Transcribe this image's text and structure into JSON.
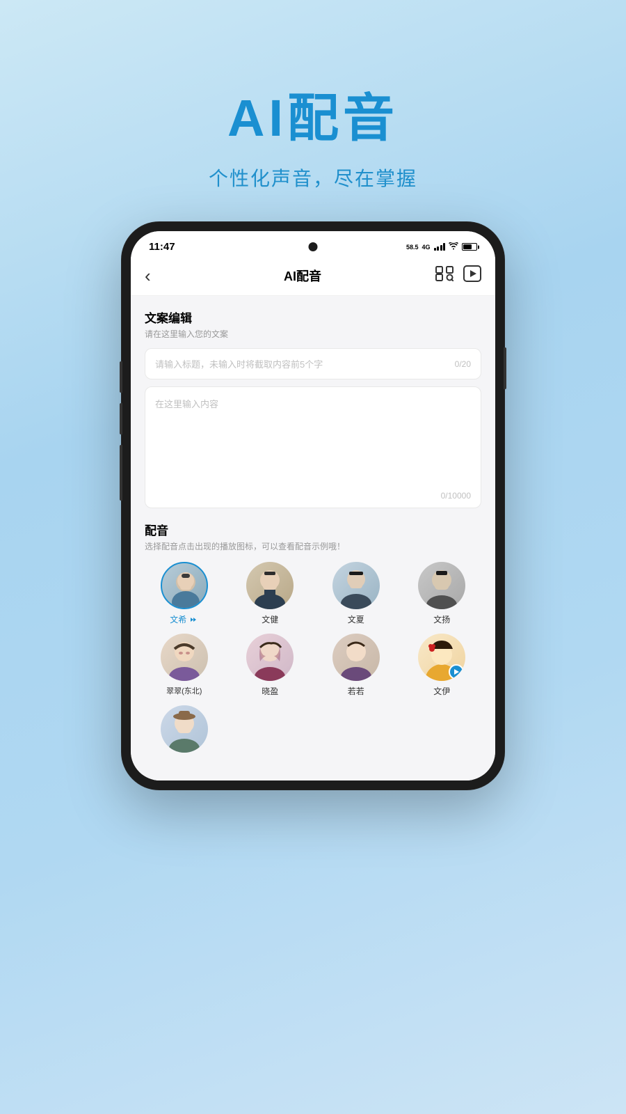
{
  "page": {
    "background": "linear-gradient(160deg, #c8e8f8 0%, #a8d4f0 40%, #b8ddf5 70%, #d0eaf8 100%)",
    "main_title": "AI配音",
    "main_subtitle": "个性化声音，尽在掌握"
  },
  "phone": {
    "status_bar": {
      "time": "11:47",
      "signal": "58.5",
      "network": "4G"
    },
    "nav": {
      "title": "AI配音",
      "back_label": "‹"
    },
    "copy_section": {
      "title": "文案编辑",
      "subtitle": "请在这里输入您的文案",
      "title_input_placeholder": "请输入标题，未输入时将截取内容前5个字",
      "title_input_count": "0/20",
      "content_input_placeholder": "在这里输入内容",
      "content_input_count": "0/10000"
    },
    "voice_section": {
      "title": "配音",
      "subtitle": "选择配音点击出现的播放图标，可以查看配音示例哦！",
      "voices": [
        {
          "id": "wenxi",
          "name": "文希",
          "selected": true,
          "avatar_type": "male-1"
        },
        {
          "id": "wenjian",
          "name": "文健",
          "selected": false,
          "avatar_type": "male-2"
        },
        {
          "id": "wenxia",
          "name": "文夏",
          "selected": false,
          "avatar_type": "male-3"
        },
        {
          "id": "wenyang",
          "name": "文扬",
          "selected": false,
          "avatar_type": "male-4"
        },
        {
          "id": "cuicui",
          "name": "翠翠(东北)",
          "selected": false,
          "avatar_type": "female-1"
        },
        {
          "id": "xiaoying",
          "name": "晓盈",
          "selected": false,
          "avatar_type": "female-2"
        },
        {
          "id": "ruoruo",
          "name": "若若",
          "selected": false,
          "avatar_type": "female-3"
        },
        {
          "id": "wenyi",
          "name": "文伊",
          "selected": false,
          "active": true,
          "avatar_type": "female-4-active"
        },
        {
          "id": "unknown",
          "name": "",
          "selected": false,
          "avatar_type": "female-5"
        }
      ]
    }
  }
}
